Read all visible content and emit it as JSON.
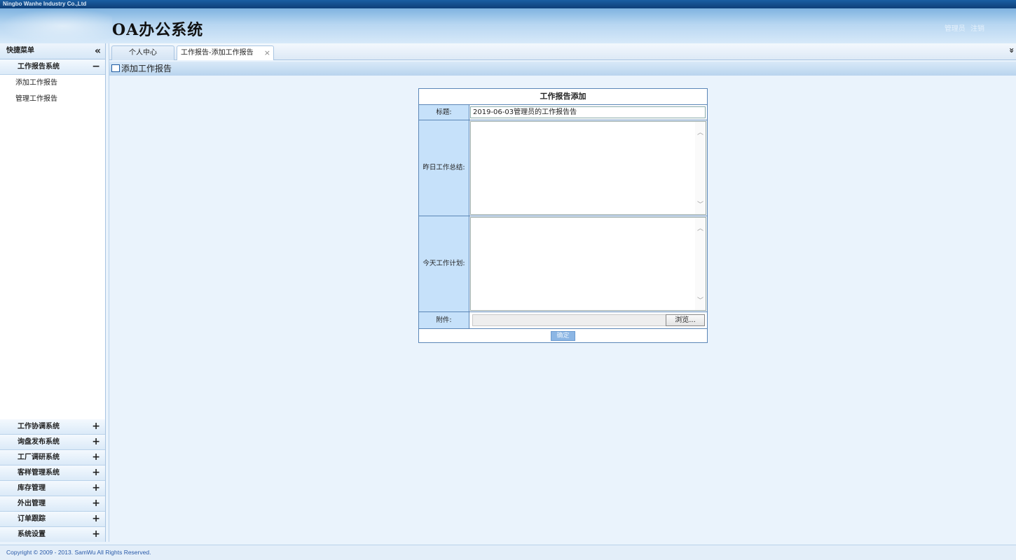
{
  "company": "Ningbo Wanhe Industry Co.,Ltd",
  "app_title": "OA办公系统",
  "user": {
    "name": "管理员",
    "logout": "注销"
  },
  "sidebar": {
    "header": "快捷菜单",
    "collapse_icon": "«",
    "open_group": {
      "label": "工作报告系统",
      "toggle": "−",
      "items": [
        "添加工作报告",
        "管理工作报告"
      ]
    },
    "groups": [
      {
        "label": "工作协调系统",
        "toggle": "+"
      },
      {
        "label": "询盘发布系统",
        "toggle": "+"
      },
      {
        "label": "工厂调研系统",
        "toggle": "+"
      },
      {
        "label": "客样管理系统",
        "toggle": "+"
      },
      {
        "label": "库存管理",
        "toggle": "+"
      },
      {
        "label": "外出管理",
        "toggle": "+"
      },
      {
        "label": "订单跟踪",
        "toggle": "+"
      },
      {
        "label": "系统设置",
        "toggle": "+"
      }
    ]
  },
  "tabs": [
    {
      "label": "个人中心"
    },
    {
      "label": "工作报告-添加工作报告",
      "close": "×"
    }
  ],
  "tab_menu_icon": "»",
  "panel_title": "添加工作报告",
  "form": {
    "heading": "工作报告添加",
    "title_label": "标题:",
    "title_value": "2019-06-03管理员的工作报告告",
    "yesterday_label": "昨日工作总结:",
    "today_label": "今天工作计划:",
    "attachment_label": "附件:",
    "browse_label": "浏览...",
    "submit_label": "确定"
  },
  "footer": "Copyright © 2009 - 2013. SamWu All Rights Reserved."
}
